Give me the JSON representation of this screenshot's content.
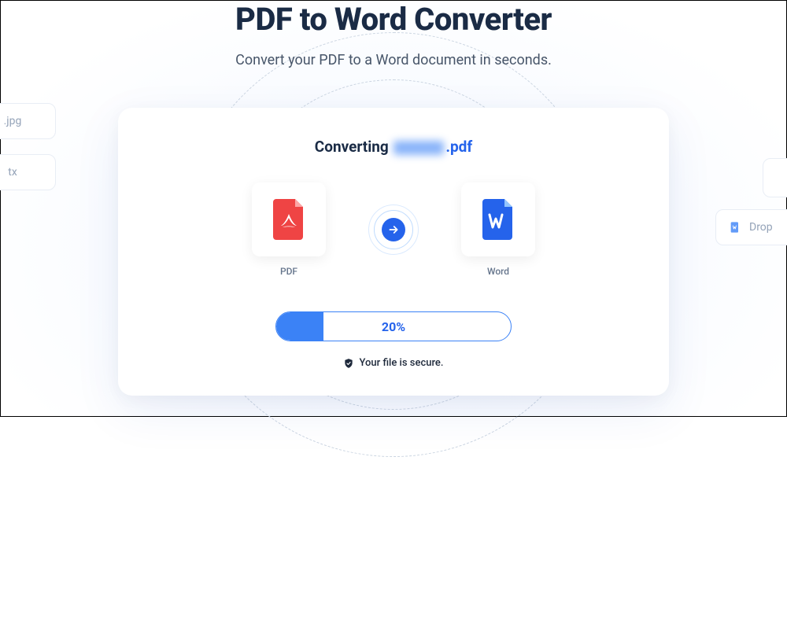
{
  "header": {
    "title": "PDF to Word Converter",
    "subtitle": "Convert your PDF to a Word document in seconds."
  },
  "converter": {
    "converting_prefix": "Converting",
    "file_ext": ".pdf",
    "from_label": "PDF",
    "to_label": "Word"
  },
  "progress": {
    "percent_text": "20%",
    "fill_width": "20%"
  },
  "secure": {
    "text": "Your file is secure."
  },
  "side": {
    "left1": ".jpg",
    "left2": "tx",
    "right2": "Drop"
  }
}
